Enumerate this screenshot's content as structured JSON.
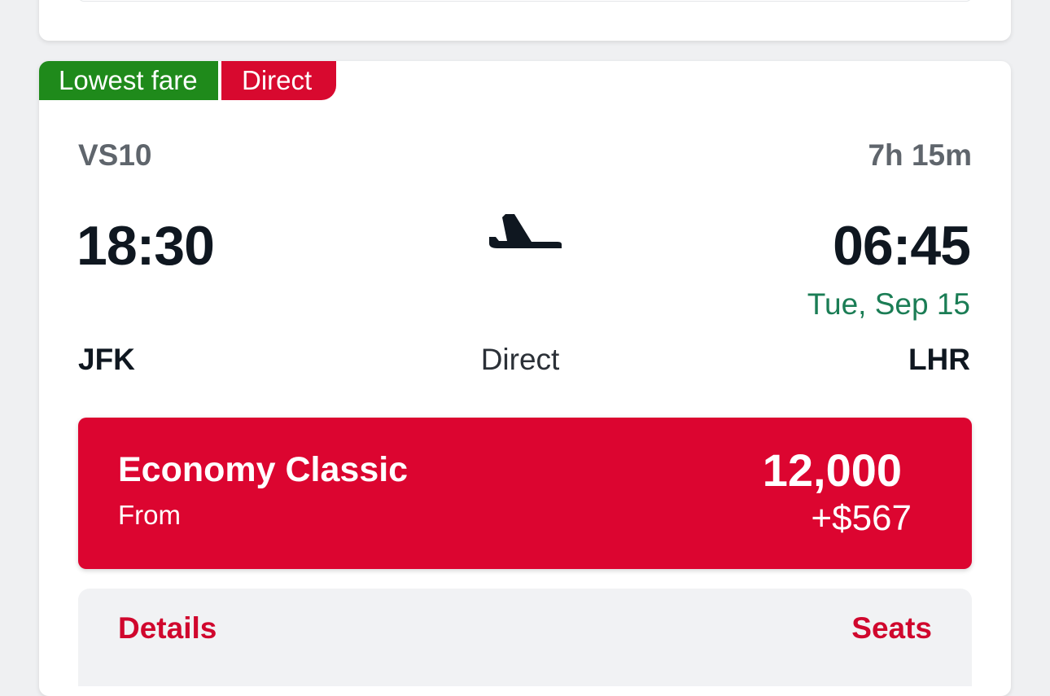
{
  "card": {
    "badges": [
      "Lowest fare",
      "Direct"
    ],
    "flight_number": "VS10",
    "duration": "7h 15m",
    "departure": {
      "time": "18:30",
      "airport": "JFK"
    },
    "arrival": {
      "time": "06:45",
      "date": "Tue, Sep 15",
      "airport": "LHR"
    },
    "stops": "Direct",
    "icon": "plane-icon",
    "fare": {
      "name": "Economy Classic",
      "from_label": "From",
      "points": "12,000",
      "cash": "+$567"
    },
    "actions": {
      "details": "Details",
      "seats": "Seats"
    }
  },
  "colors": {
    "brand_red": "#dc0530",
    "badge_green": "#1f8a1b",
    "date_green": "#1b7d55"
  }
}
